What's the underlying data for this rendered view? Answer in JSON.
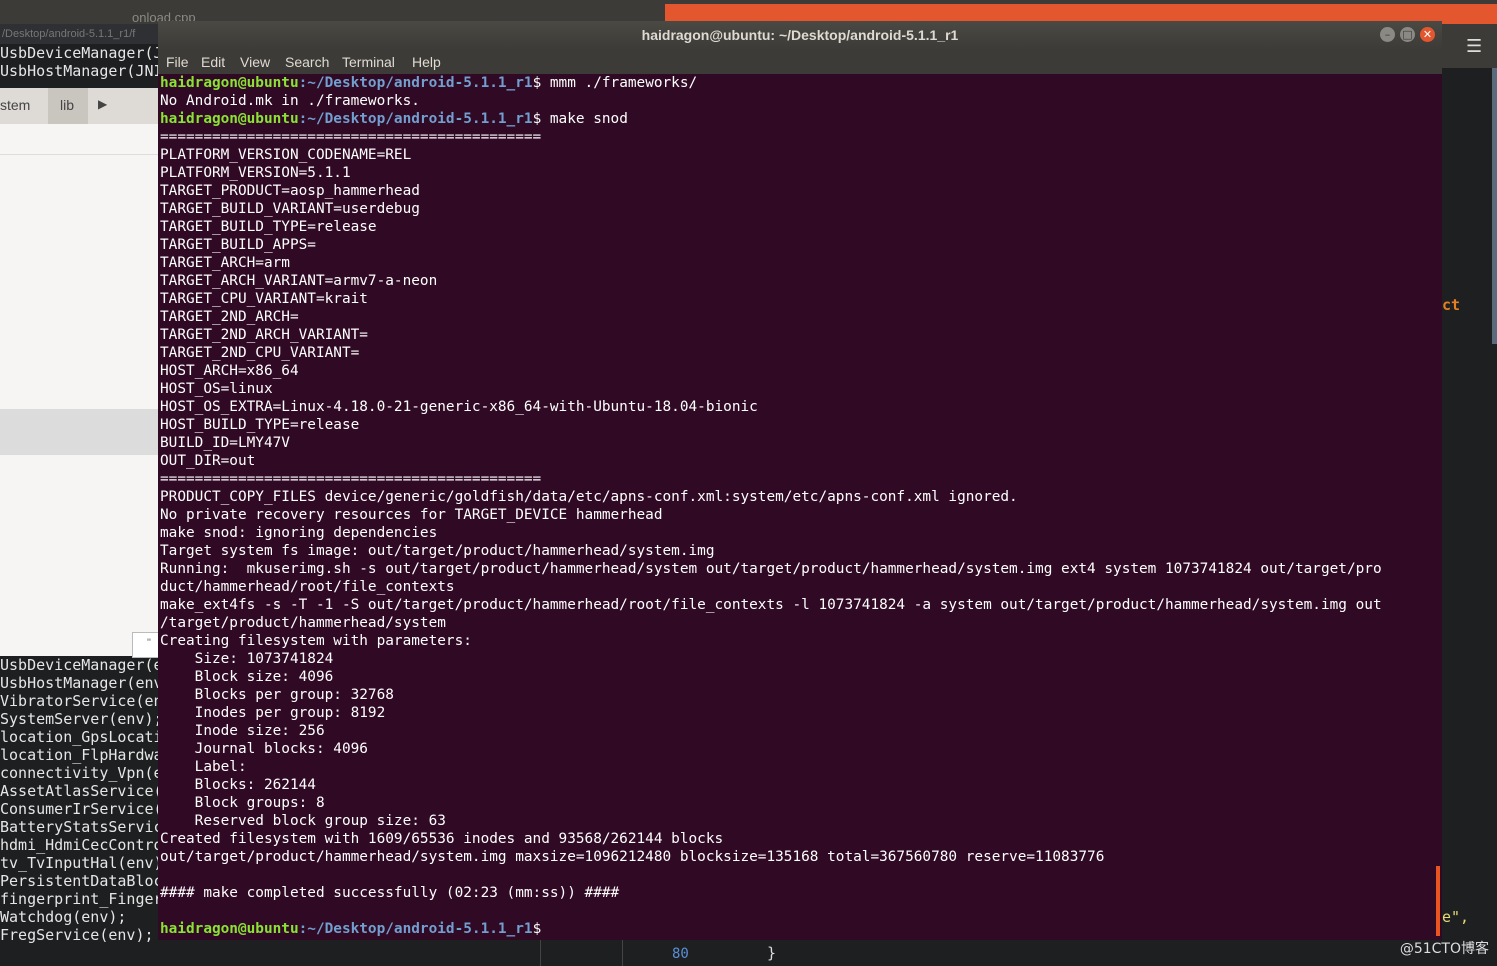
{
  "background": {
    "top_file_name": "onload.cpp",
    "file_manager": {
      "path": "/Desktop/android-5.1.1_r1/f",
      "crumb_left": "stem",
      "crumb_lib": "lib",
      "tooltip": "\""
    },
    "editor_lines_top": [
      "UsbDeviceManager(J",
      "UsbHostManager(JNI"
    ],
    "editor_lines_bottom": [
      "UsbDeviceManager(e",
      "UsbHostManager(env",
      "VibratorService(en",
      "SystemServer(env);",
      "location_GpsLocati",
      "location_FlpHardwa",
      "connectivity_Vpn(e",
      "AssetAtlasService(",
      "ConsumerIrService(",
      "BatteryStatsServic",
      "hdmi_HdmiCecContro",
      "tv_TvInputHal(env)",
      "PersistentDataBloc",
      "fingerprint_Finger",
      "Watchdog(env);",
      "FregService(env);"
    ],
    "right_fragment_1": "ct",
    "right_fragment_2": "e\",",
    "bottom_line_number": "80",
    "bottom_code": "}",
    "watermark": "@51CTO博客"
  },
  "terminal": {
    "title": "haidragon@ubuntu: ~/Desktop/android-5.1.1_r1",
    "menu": [
      "File",
      "Edit",
      "View",
      "Search",
      "Terminal",
      "Help"
    ],
    "prompt_user": "haidragon@ubuntu",
    "prompt_path": ":~/Desktop/android-5.1.1_r1",
    "cmd1": "$ mmm ./frameworks/",
    "out1": "No Android.mk in ./frameworks.",
    "cmd2": "$ make snod",
    "output": [
      "============================================",
      "PLATFORM_VERSION_CODENAME=REL",
      "PLATFORM_VERSION=5.1.1",
      "TARGET_PRODUCT=aosp_hammerhead",
      "TARGET_BUILD_VARIANT=userdebug",
      "TARGET_BUILD_TYPE=release",
      "TARGET_BUILD_APPS=",
      "TARGET_ARCH=arm",
      "TARGET_ARCH_VARIANT=armv7-a-neon",
      "TARGET_CPU_VARIANT=krait",
      "TARGET_2ND_ARCH=",
      "TARGET_2ND_ARCH_VARIANT=",
      "TARGET_2ND_CPU_VARIANT=",
      "HOST_ARCH=x86_64",
      "HOST_OS=linux",
      "HOST_OS_EXTRA=Linux-4.18.0-21-generic-x86_64-with-Ubuntu-18.04-bionic",
      "HOST_BUILD_TYPE=release",
      "BUILD_ID=LMY47V",
      "OUT_DIR=out",
      "============================================",
      "PRODUCT_COPY_FILES device/generic/goldfish/data/etc/apns-conf.xml:system/etc/apns-conf.xml ignored.",
      "No private recovery resources for TARGET_DEVICE hammerhead",
      "make snod: ignoring dependencies",
      "Target system fs image: out/target/product/hammerhead/system.img",
      "Running:  mkuserimg.sh -s out/target/product/hammerhead/system out/target/product/hammerhead/system.img ext4 system 1073741824 out/target/pro",
      "duct/hammerhead/root/file_contexts",
      "make_ext4fs -s -T -1 -S out/target/product/hammerhead/root/file_contexts -l 1073741824 -a system out/target/product/hammerhead/system.img out",
      "/target/product/hammerhead/system",
      "Creating filesystem with parameters:",
      "    Size: 1073741824",
      "    Block size: 4096",
      "    Blocks per group: 32768",
      "    Inodes per group: 8192",
      "    Inode size: 256",
      "    Journal blocks: 4096",
      "    Label: ",
      "    Blocks: 262144",
      "    Block groups: 8",
      "    Reserved block group size: 63",
      "Created filesystem with 1609/65536 inodes and 93568/262144 blocks",
      "out/target/product/hammerhead/system.img maxsize=1096212480 blocksize=135168 total=367560780 reserve=11083776",
      "",
      "#### make completed successfully (02:23 (mm:ss)) ####",
      ""
    ],
    "final_prompt_suffix": "$"
  }
}
